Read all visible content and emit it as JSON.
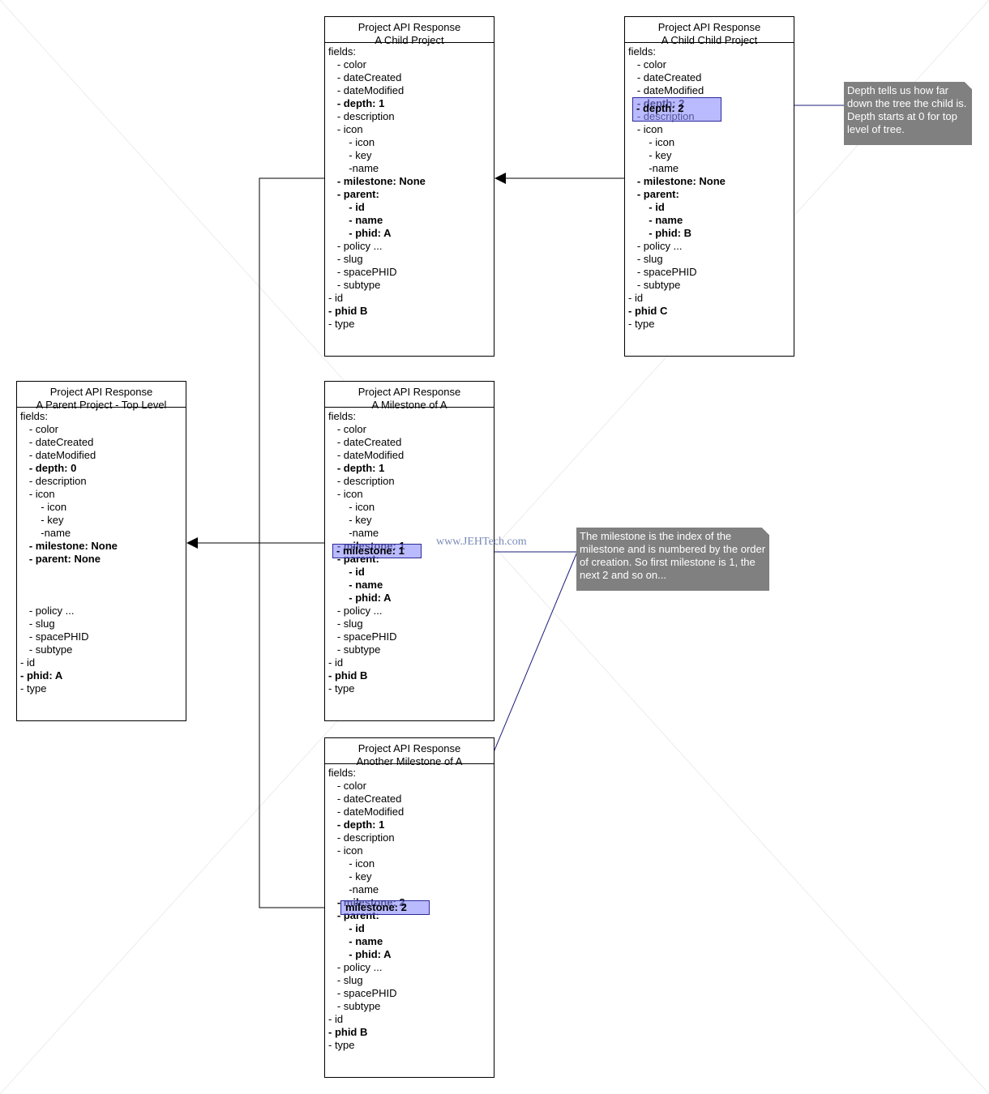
{
  "watermark": "www.JEHTech.com",
  "boxes": {
    "child": {
      "title": [
        "Project API Response",
        "A Child Project"
      ],
      "rows": [
        {
          "t": "fields:",
          "b": false
        },
        {
          "t": "   - color",
          "b": false
        },
        {
          "t": "   - dateCreated",
          "b": false
        },
        {
          "t": "   - dateModified",
          "b": false
        },
        {
          "t": "   - depth: 1",
          "b": true
        },
        {
          "t": "   - description",
          "b": false
        },
        {
          "t": "   - icon",
          "b": false
        },
        {
          "t": "       - icon",
          "b": false
        },
        {
          "t": "       - key",
          "b": false
        },
        {
          "t": "       -name",
          "b": false
        },
        {
          "t": "   - milestone: None",
          "b": true
        },
        {
          "t": "   - parent:",
          "b": true
        },
        {
          "t": "       - id",
          "b": true
        },
        {
          "t": "       - name",
          "b": true
        },
        {
          "t": "       - phid: A",
          "b": true
        },
        {
          "t": "   - policy ...",
          "b": false
        },
        {
          "t": "   - slug",
          "b": false
        },
        {
          "t": "   - spacePHID",
          "b": false
        },
        {
          "t": "   - subtype",
          "b": false
        },
        {
          "t": "- id",
          "b": false
        },
        {
          "t": "- phid B",
          "b": true
        },
        {
          "t": "- type",
          "b": false
        }
      ]
    },
    "childchild": {
      "title": [
        "Project API Response",
        "A Child Child Project"
      ],
      "rows": [
        {
          "t": "fields:",
          "b": false
        },
        {
          "t": "   - color",
          "b": false
        },
        {
          "t": "   - dateCreated",
          "b": false
        },
        {
          "t": "   - dateModified",
          "b": false
        },
        {
          "t": "   - depth: 2",
          "b": true
        },
        {
          "t": "   - description",
          "b": false
        },
        {
          "t": "   - icon",
          "b": false
        },
        {
          "t": "       - icon",
          "b": false
        },
        {
          "t": "       - key",
          "b": false
        },
        {
          "t": "       -name",
          "b": false
        },
        {
          "t": "   - milestone: None",
          "b": true
        },
        {
          "t": "   - parent:",
          "b": true
        },
        {
          "t": "       - id",
          "b": true
        },
        {
          "t": "       - name",
          "b": true
        },
        {
          "t": "       - phid: B",
          "b": true
        },
        {
          "t": "   - policy ...",
          "b": false
        },
        {
          "t": "   - slug",
          "b": false
        },
        {
          "t": "   - spacePHID",
          "b": false
        },
        {
          "t": "   - subtype",
          "b": false
        },
        {
          "t": "- id",
          "b": false
        },
        {
          "t": "- phid C",
          "b": true
        },
        {
          "t": "- type",
          "b": false
        }
      ]
    },
    "parent": {
      "title": [
        "Project API Response",
        "A Parent Project - Top Level"
      ],
      "rows": [
        {
          "t": "fields:",
          "b": false
        },
        {
          "t": "   - color",
          "b": false
        },
        {
          "t": "   - dateCreated",
          "b": false
        },
        {
          "t": "   - dateModified",
          "b": false
        },
        {
          "t": "   - depth: 0",
          "b": true
        },
        {
          "t": "   - description",
          "b": false
        },
        {
          "t": "   - icon",
          "b": false
        },
        {
          "t": "       - icon",
          "b": false
        },
        {
          "t": "       - key",
          "b": false
        },
        {
          "t": "       -name",
          "b": false
        },
        {
          "t": "   - milestone: None",
          "b": true
        },
        {
          "t": "   - parent: None",
          "b": true
        },
        {
          "t": "",
          "b": false
        },
        {
          "t": "",
          "b": false
        },
        {
          "t": "",
          "b": false
        },
        {
          "t": "   - policy ...",
          "b": false
        },
        {
          "t": "   - slug",
          "b": false
        },
        {
          "t": "   - spacePHID",
          "b": false
        },
        {
          "t": "   - subtype",
          "b": false
        },
        {
          "t": "- id",
          "b": false
        },
        {
          "t": "- phid: A",
          "b": true
        },
        {
          "t": "- type",
          "b": false
        }
      ]
    },
    "milestone1": {
      "title": [
        "Project API Response",
        "A Milestone of A"
      ],
      "rows": [
        {
          "t": "fields:",
          "b": false
        },
        {
          "t": "   - color",
          "b": false
        },
        {
          "t": "   - dateCreated",
          "b": false
        },
        {
          "t": "   - dateModified",
          "b": false
        },
        {
          "t": "   - depth: 1",
          "b": true
        },
        {
          "t": "   - description",
          "b": false
        },
        {
          "t": "   - icon",
          "b": false
        },
        {
          "t": "       - icon",
          "b": false
        },
        {
          "t": "       - key",
          "b": false
        },
        {
          "t": "       -name",
          "b": false
        },
        {
          "t": "   - milestone: 1",
          "b": true
        },
        {
          "t": "   - parent:",
          "b": true
        },
        {
          "t": "       - id",
          "b": true
        },
        {
          "t": "       - name",
          "b": true
        },
        {
          "t": "       - phid: A",
          "b": true
        },
        {
          "t": "   - policy ...",
          "b": false
        },
        {
          "t": "   - slug",
          "b": false
        },
        {
          "t": "   - spacePHID",
          "b": false
        },
        {
          "t": "   - subtype",
          "b": false
        },
        {
          "t": "- id",
          "b": false
        },
        {
          "t": "- phid B",
          "b": true
        },
        {
          "t": "- type",
          "b": false
        }
      ]
    },
    "milestone2": {
      "title": [
        "Project API Response",
        "Another Milestone of A"
      ],
      "rows": [
        {
          "t": "fields:",
          "b": false
        },
        {
          "t": "   - color",
          "b": false
        },
        {
          "t": "   - dateCreated",
          "b": false
        },
        {
          "t": "   - dateModified",
          "b": false
        },
        {
          "t": "   - depth: 1",
          "b": true
        },
        {
          "t": "   - description",
          "b": false
        },
        {
          "t": "   - icon",
          "b": false
        },
        {
          "t": "       - icon",
          "b": false
        },
        {
          "t": "       - key",
          "b": false
        },
        {
          "t": "       -name",
          "b": false
        },
        {
          "t": "   - milestone: 2",
          "b": true
        },
        {
          "t": "   - parent:",
          "b": true
        },
        {
          "t": "       - id",
          "b": true
        },
        {
          "t": "       - name",
          "b": true
        },
        {
          "t": "       - phid: A",
          "b": true
        },
        {
          "t": "   - policy ...",
          "b": false
        },
        {
          "t": "   - slug",
          "b": false
        },
        {
          "t": "   - spacePHID",
          "b": false
        },
        {
          "t": "   - subtype",
          "b": false
        },
        {
          "t": "- id",
          "b": false
        },
        {
          "t": "- phid B",
          "b": true
        },
        {
          "t": "- type",
          "b": false
        }
      ]
    }
  },
  "highlights": {
    "depth2": "- depth: 2",
    "milestone1": "- milestone: 1",
    "milestone2": "milestone: 2"
  },
  "notes": {
    "depth": "Depth tells us how far down the tree the child is. Depth starts at 0 for top level of tree.",
    "milestone": "The milestone is the index of the milestone and is numbered by the order of creation. So first milestone is 1, the next 2 and so on..."
  },
  "colors": {
    "highlight_fill": "#a5a5ff",
    "highlight_border": "#2a2a9a",
    "note_fill": "#808080",
    "callout_line": "#1c1c7a",
    "watermark": "#7a8ab8"
  }
}
